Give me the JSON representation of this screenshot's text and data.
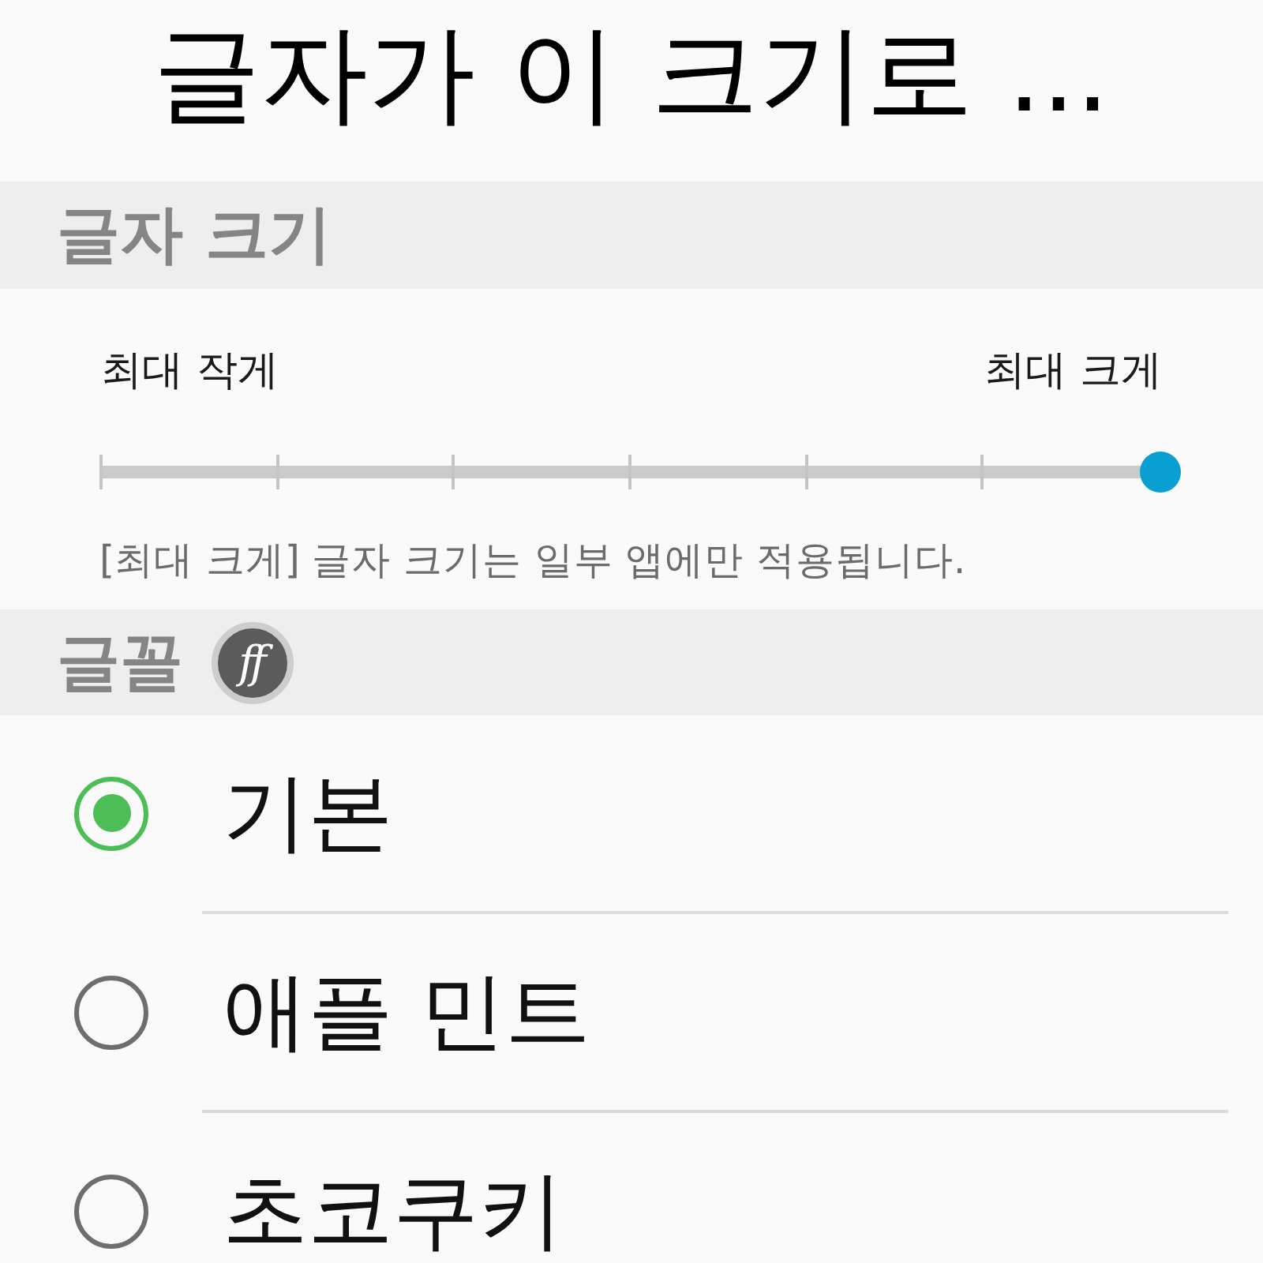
{
  "preview": {
    "text": "글자가 이 크기로 ..."
  },
  "font_size": {
    "header": "글자 크기",
    "min_label": "최대 작게",
    "max_label": "최대 크게",
    "slider": {
      "level": 1
    },
    "note": "[최대 크게] 글자 크기는 일부 앱에만 적용됩니다."
  },
  "font": {
    "header": "글꼴",
    "badge": "ff",
    "options": [
      {
        "label": "기본",
        "selected": true
      },
      {
        "label": "애플 민트",
        "selected": false
      },
      {
        "label": "초코쿠키",
        "selected": false
      }
    ]
  }
}
